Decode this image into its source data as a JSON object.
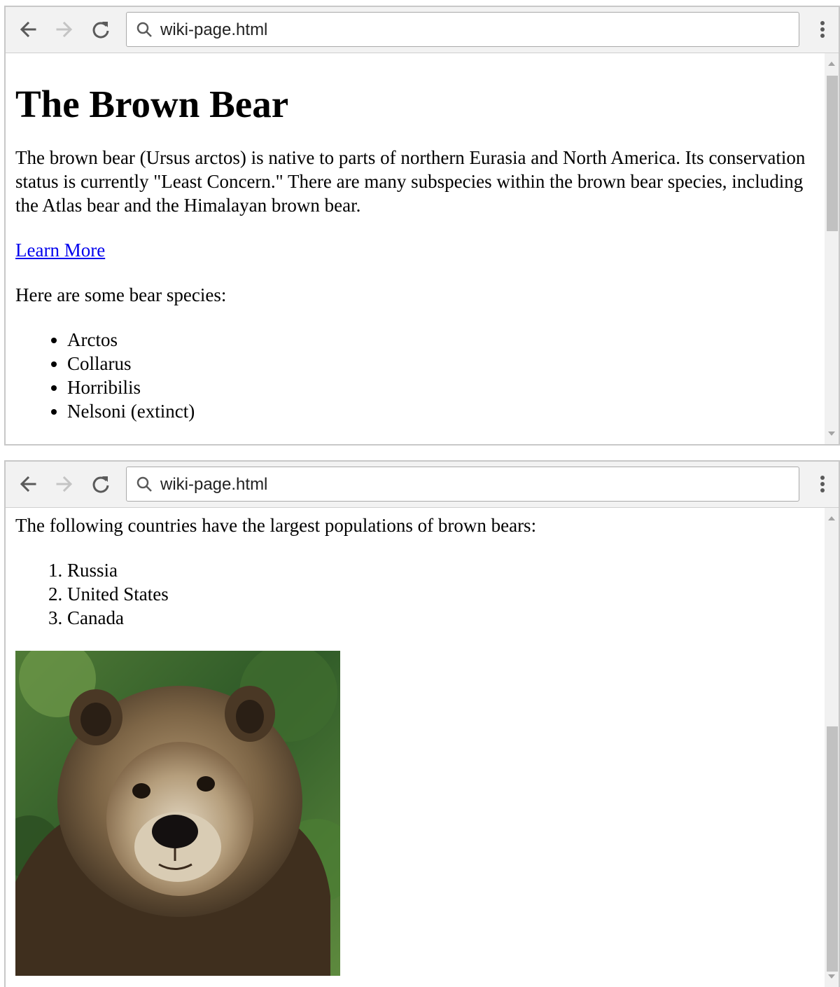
{
  "browser": {
    "url": "wiki-page.html"
  },
  "page": {
    "title": "The Brown Bear",
    "intro": "The brown bear (Ursus arctos) is native to parts of northern Eurasia and North America. Its conservation status is currently \"Least Concern.\" There are many subspecies within the brown bear species, including the Atlas bear and the Himalayan brown bear.",
    "learn_more": "Learn More",
    "species_intro": "Here are some bear species:",
    "species": [
      "Arctos",
      "Collarus",
      "Horribilis",
      "Nelsoni (extinct)"
    ],
    "countries_intro": "The following countries have the largest populations of brown bears:",
    "countries": [
      "Russia",
      "United States",
      "Canada"
    ]
  },
  "icons": {
    "back": "arrow-left-icon",
    "forward": "arrow-right-icon",
    "reload": "reload-icon",
    "search": "magnifier-icon",
    "menu": "vertical-dots-icon"
  },
  "colors": {
    "link": "#0000ee",
    "toolbar": "#f2f2f2",
    "scrollbar_thumb": "#c1c1c1"
  }
}
